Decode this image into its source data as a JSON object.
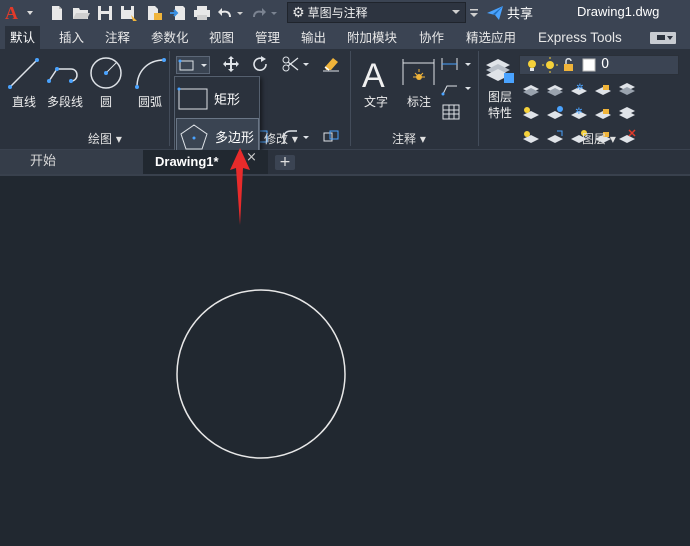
{
  "window": {
    "doc_title": "Drawing1.dwg"
  },
  "workspace": {
    "selected": "草图与注释",
    "icon": "gear-icon"
  },
  "share": {
    "label": "共享"
  },
  "ribbon_tabs": [
    "默认",
    "插入",
    "注释",
    "参数化",
    "视图",
    "管理",
    "输出",
    "附加模块",
    "协作",
    "精选应用",
    "Express Tools"
  ],
  "draw_panel": {
    "line": "直线",
    "polyline": "多段线",
    "circle": "圆",
    "arc": "圆弧",
    "footer": "绘图 ▾"
  },
  "modify_panel": {
    "footer": "修改 ▾"
  },
  "annotation_panel": {
    "text": "文字",
    "dimension": "标注",
    "footer": "注释 ▾"
  },
  "layers_panel": {
    "layer_props_line1": "图层",
    "layer_props_line2": "特性",
    "current_layer": "0",
    "footer": "图层 ▾"
  },
  "dropdown": {
    "rectangle": "矩形",
    "polygon": "多边形"
  },
  "doc_tabs": {
    "start": "开始",
    "drawing": "Drawing1*",
    "close": "×",
    "add": "+"
  },
  "colors": {
    "accent": "#e82b2b",
    "canvas": "#212830",
    "ribbon": "#2b323d",
    "titlebar": "#3b4453"
  }
}
